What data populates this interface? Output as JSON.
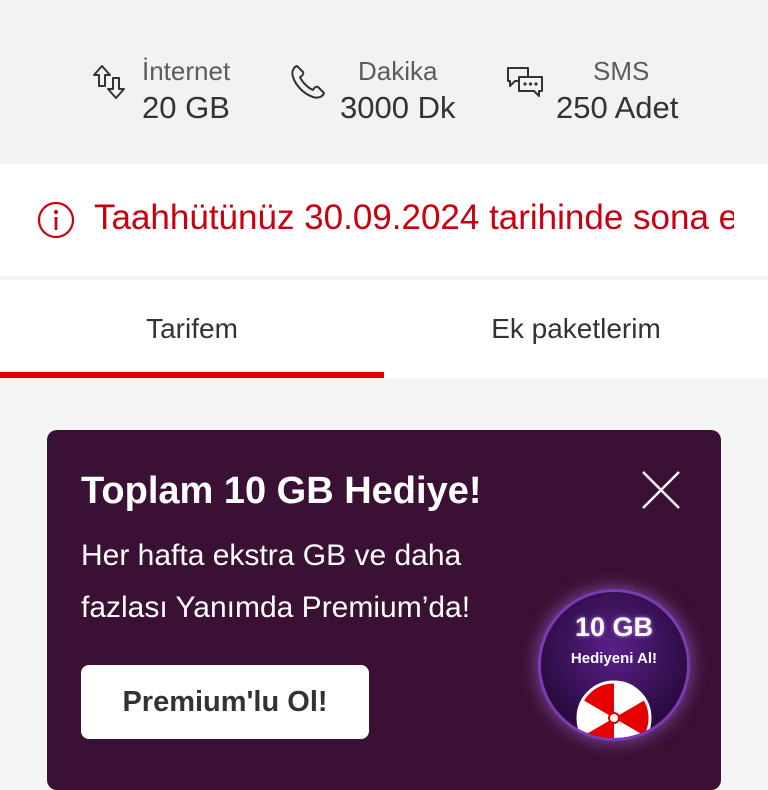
{
  "usage": {
    "internet": {
      "label": "İnternet",
      "value": "20 GB",
      "icon": "data-transfer-icon"
    },
    "dakika": {
      "label": "Dakika",
      "value": "3000 Dk",
      "icon": "phone-icon"
    },
    "sms": {
      "label": "SMS",
      "value": "250 Adet",
      "icon": "chat-bubbles-icon"
    }
  },
  "banner": {
    "message": "Taahhütünüz 30.09.2024 tarihinde sona e",
    "icon": "info-icon",
    "color": "#c8000f"
  },
  "tabs": [
    {
      "label": "Tarifem",
      "active": true
    },
    {
      "label": "Ek paketlerim",
      "active": false
    }
  ],
  "promo": {
    "title": "Toplam 10 GB Hediye!",
    "body": "Her hafta ekstra GB ve daha fazlası Yanımda Premium’da!",
    "cta": "Premium'lu Ol!",
    "badge_line1": "10 GB",
    "badge_line2": "Hediyeni Al!",
    "background": "#3a1034"
  },
  "accent_color": "#e60000"
}
